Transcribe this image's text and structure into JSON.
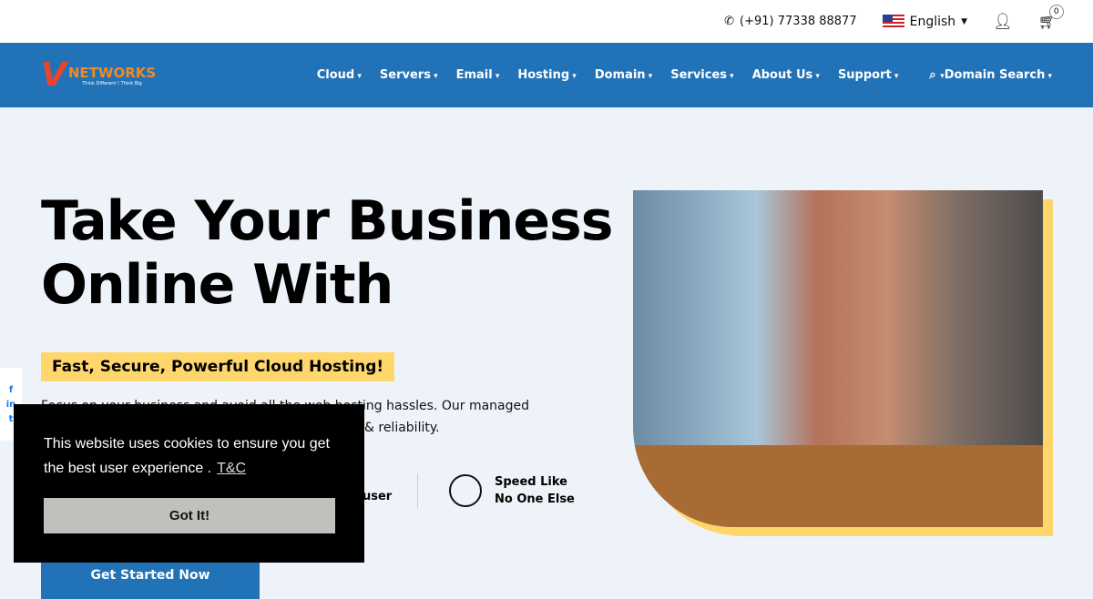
{
  "topbar": {
    "phone": "(+91) 77338 88877",
    "language": "English",
    "cart_count": "0"
  },
  "logo": {
    "text": "NETWORKS",
    "tagline": "Think Different ! Think Big"
  },
  "nav": [
    "Cloud",
    "Servers",
    "Email",
    "Hosting",
    "Domain",
    "Services",
    "About Us",
    "Support"
  ],
  "domain_search": "Domain Search",
  "hero": {
    "title_line1": "Take Your Business",
    "title_line2": "Online With",
    "tagline": "Fast, Secure, Powerful Cloud Hosting!",
    "desc_line1": "Focus on your business and avoid all the web hosting hassles. Our managed",
    "desc_line2": "& reliability.",
    "feature1": "user",
    "feature2_line1": "Speed Like",
    "feature2_line2": "No One Else",
    "cta": "Get Started Now"
  },
  "cookie": {
    "message": "This website uses cookies to ensure you get the best user experience .",
    "link": "T&C",
    "button": "Got It!"
  },
  "colors": {
    "nav": "#2272b7",
    "accent": "#fed66b"
  }
}
